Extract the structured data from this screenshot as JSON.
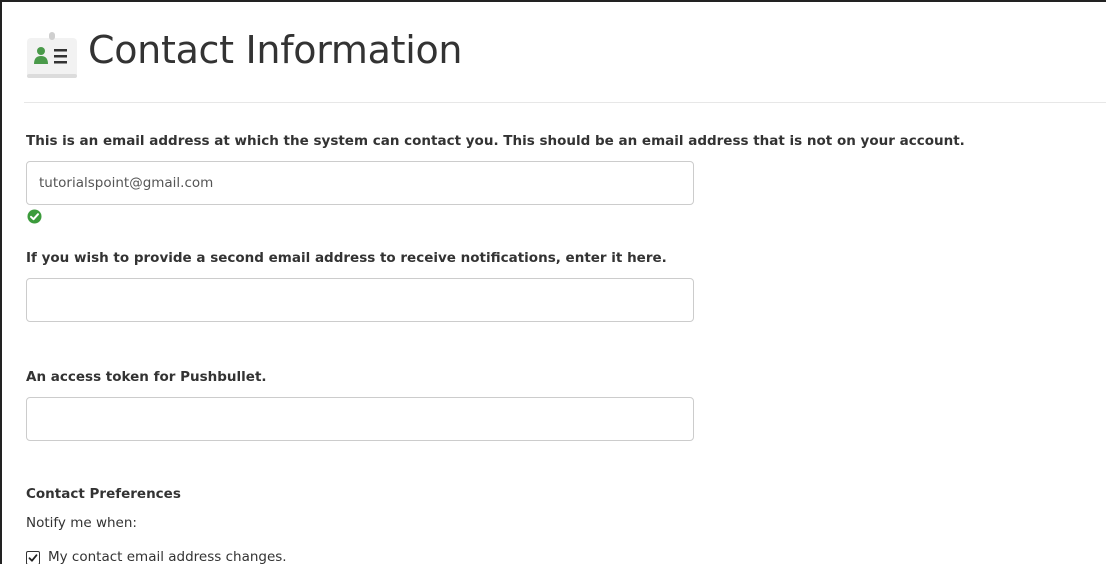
{
  "header": {
    "title": "Contact Information",
    "icon": "contact-card-icon"
  },
  "form": {
    "primary_email": {
      "label": "This is an email address at which the system can contact you. This should be an email address that is not on your account.",
      "value": "tutorialspoint@gmail.com",
      "placeholder": "",
      "status_icon": "valid-check-icon",
      "status_color": "#3c9b3c"
    },
    "secondary_email": {
      "label": "If you wish to provide a second email address to receive notifications, enter it here.",
      "value": "",
      "placeholder": ""
    },
    "pushbullet_token": {
      "label": "An access token for Pushbullet.",
      "value": "",
      "placeholder": ""
    }
  },
  "preferences": {
    "heading": "Contact Preferences",
    "intro": "Notify me when:",
    "items": [
      {
        "label": "My contact email address changes.",
        "checked": true
      }
    ]
  },
  "colors": {
    "accent_green": "#3c9b3c",
    "input_border": "#cccccc",
    "text": "#333333"
  }
}
